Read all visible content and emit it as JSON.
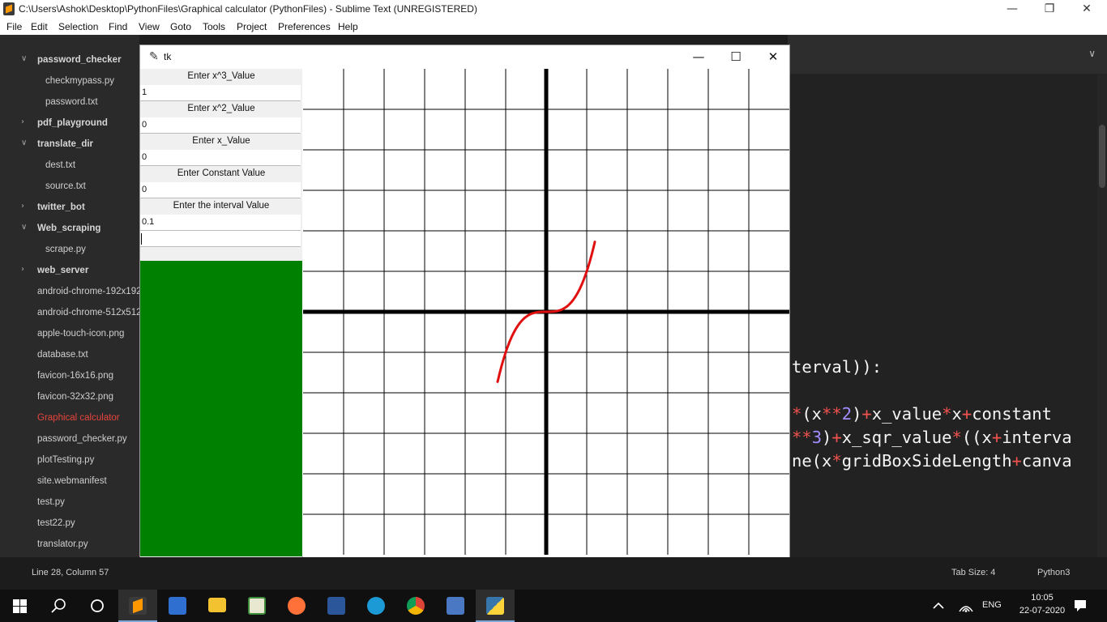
{
  "sublime": {
    "title": "C:\\Users\\Ashok\\Desktop\\PythonFiles\\Graphical calculator (PythonFiles) - Sublime Text (UNREGISTERED)",
    "menu": [
      "File",
      "Edit",
      "Selection",
      "Find",
      "View",
      "Goto",
      "Tools",
      "Project",
      "Preferences",
      "Help"
    ],
    "window_buttons": {
      "minimize": "—",
      "restore": "❐",
      "close": "✕"
    }
  },
  "sidebar": {
    "items": [
      {
        "label": "password_checker",
        "type": "folder",
        "expanded": true
      },
      {
        "label": "checkmypass.py",
        "type": "file"
      },
      {
        "label": "password.txt",
        "type": "file"
      },
      {
        "label": "pdf_playground",
        "type": "folder",
        "expanded": false
      },
      {
        "label": "translate_dir",
        "type": "folder",
        "expanded": true
      },
      {
        "label": "dest.txt",
        "type": "file"
      },
      {
        "label": "source.txt",
        "type": "file"
      },
      {
        "label": "twitter_bot",
        "type": "folder",
        "expanded": false
      },
      {
        "label": "Web_scraping",
        "type": "folder",
        "expanded": true
      },
      {
        "label": "scrape.py",
        "type": "file"
      },
      {
        "label": "web_server",
        "type": "folder",
        "expanded": false
      },
      {
        "label": "android-chrome-192x192.png",
        "type": "rootfile"
      },
      {
        "label": "android-chrome-512x512.png",
        "type": "rootfile"
      },
      {
        "label": "apple-touch-icon.png",
        "type": "rootfile"
      },
      {
        "label": "database.txt",
        "type": "rootfile"
      },
      {
        "label": "favicon-16x16.png",
        "type": "rootfile"
      },
      {
        "label": "favicon-32x32.png",
        "type": "rootfile"
      },
      {
        "label": "Graphical calculator",
        "type": "rootfile",
        "active": true
      },
      {
        "label": "password_checker.py",
        "type": "rootfile"
      },
      {
        "label": "plotTesting.py",
        "type": "rootfile"
      },
      {
        "label": "site.webmanifest",
        "type": "rootfile"
      },
      {
        "label": "test.py",
        "type": "rootfile"
      },
      {
        "label": "test22.py",
        "type": "rootfile"
      },
      {
        "label": "translator.py",
        "type": "rootfile"
      }
    ],
    "arrows": {
      "expanded": "∨",
      "collapsed": "›"
    }
  },
  "editor": {
    "tab_dropdown": "∨",
    "code_lines": [
      [
        {
          "t": "terval)):",
          "c": "plain"
        }
      ],
      [
        {
          "t": "*",
          "c": "op"
        },
        {
          "t": "(x",
          "c": "plain"
        },
        {
          "t": "**",
          "c": "op"
        },
        {
          "t": "2",
          "c": "num"
        },
        {
          "t": ")",
          "c": "plain"
        },
        {
          "t": "+",
          "c": "op"
        },
        {
          "t": "x_value",
          "c": "plain"
        },
        {
          "t": "*",
          "c": "op"
        },
        {
          "t": "x",
          "c": "plain"
        },
        {
          "t": "+",
          "c": "op"
        },
        {
          "t": "constant",
          "c": "plain"
        }
      ],
      [
        {
          "t": "**",
          "c": "op"
        },
        {
          "t": "3",
          "c": "num"
        },
        {
          "t": ")",
          "c": "plain"
        },
        {
          "t": "+",
          "c": "op"
        },
        {
          "t": "x_sqr_value",
          "c": "plain"
        },
        {
          "t": "*",
          "c": "op"
        },
        {
          "t": "((x",
          "c": "plain"
        },
        {
          "t": "+",
          "c": "op"
        },
        {
          "t": "interva",
          "c": "plain"
        }
      ],
      [
        {
          "t": "ne(x",
          "c": "plain"
        },
        {
          "t": "*",
          "c": "op"
        },
        {
          "t": "gridBoxSideLength",
          "c": "plain"
        },
        {
          "t": "+",
          "c": "op"
        },
        {
          "t": "canva",
          "c": "plain"
        }
      ]
    ]
  },
  "statusbar": {
    "position": "Line 28, Column 57",
    "tab_size": "Tab Size: 4",
    "syntax": "Python3"
  },
  "tk": {
    "title": "tk",
    "window_buttons": {
      "minimize": "—",
      "maximize": "☐",
      "close": "✕"
    },
    "form": {
      "cubic_label": "Enter x^3_Value",
      "cubic_value": "1",
      "square_label": "Enter x^2_Value",
      "square_value": "0",
      "linear_label": "Enter x_Value",
      "linear_value": "0",
      "constant_label": "Enter Constant Value",
      "constant_value": "0",
      "interval_label": "Enter the interval Value",
      "interval_value": "0.1",
      "extra_value": ""
    },
    "plot": {
      "grid_size": 12,
      "cubic": 1,
      "square": 0,
      "linear": 0,
      "constant": 0,
      "interval": 0.1,
      "x_start": -1.2,
      "x_end": 1.2,
      "curve_color": "#e01010",
      "axis_color": "#000000",
      "button_color": "#008000"
    }
  },
  "taskbar": {
    "apps": [
      "sublime-text",
      "calculator",
      "file-explorer",
      "excel-chart",
      "firefox",
      "word",
      "edge",
      "chrome",
      "control-panel",
      "python"
    ],
    "tray": {
      "language": "ENG",
      "time": "10:05",
      "date": "22-07-2020"
    }
  }
}
